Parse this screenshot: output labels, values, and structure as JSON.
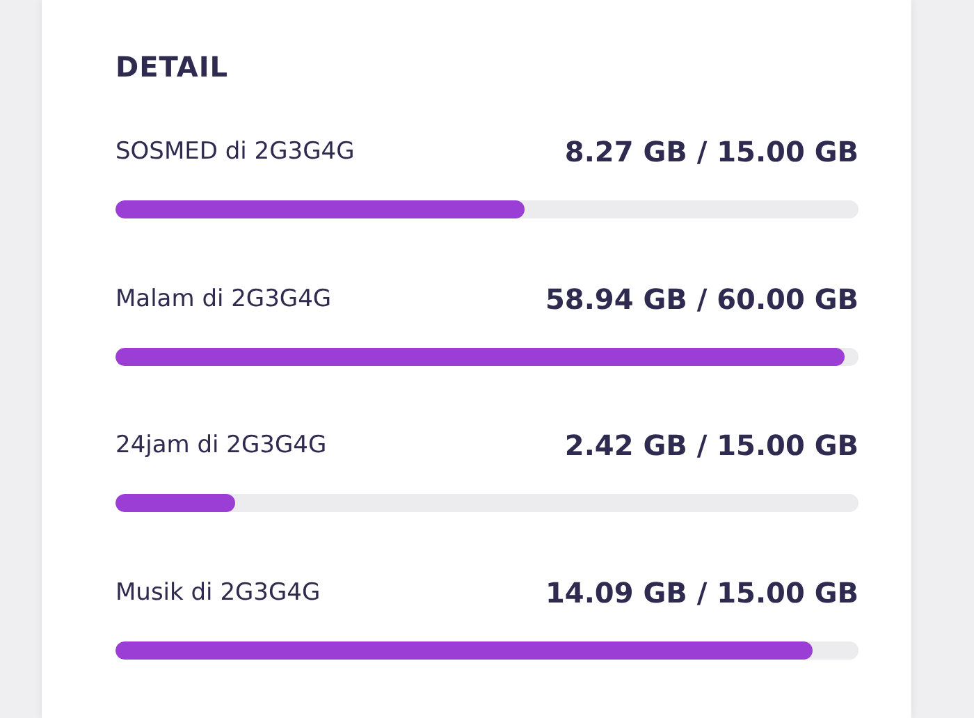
{
  "section": {
    "title": "DETAIL"
  },
  "quotas": [
    {
      "name": "SOSMED di 2G3G4G",
      "usage": "8.27 GB / 15.00 GB",
      "level": 0.551
    },
    {
      "name": "Malam di 2G3G4G",
      "usage": "58.94 GB / 60.00 GB",
      "level": 0.982
    },
    {
      "name": "24jam di 2G3G4G",
      "usage": "2.42 GB / 15.00 GB",
      "level": 0.161
    },
    {
      "name": "Musik di 2G3G4G",
      "usage": "14.09 GB / 15.00 GB",
      "level": 0.939
    }
  ]
}
